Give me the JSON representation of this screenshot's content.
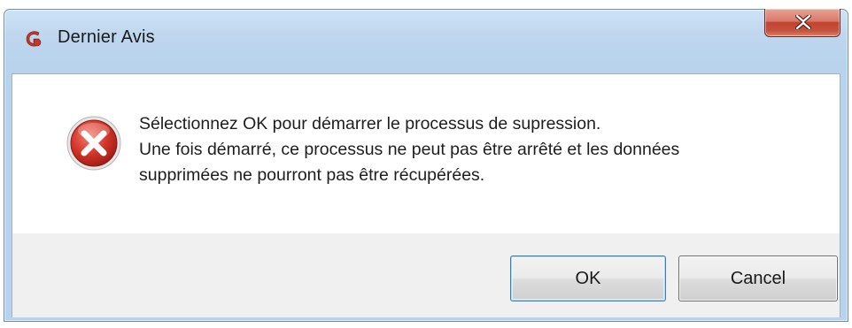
{
  "window": {
    "title": "Dernier Avis"
  },
  "message": {
    "line1": "Sélectionnez OK pour démarrer le processus de supression.",
    "line2": "Une fois démarré, ce processus ne peut pas être arrêté et les données",
    "line3": "supprimées ne pourront pas être récupérées."
  },
  "buttons": {
    "ok_label": "OK",
    "cancel_label": "Cancel"
  },
  "icons": {
    "app": "app-logo-icon",
    "error": "error-icon",
    "close": "close-icon"
  },
  "colors": {
    "titlebar": "#bfd6ee",
    "close_button": "#c7503b",
    "error_icon": "#c62828",
    "footer": "#f0f0f0"
  }
}
